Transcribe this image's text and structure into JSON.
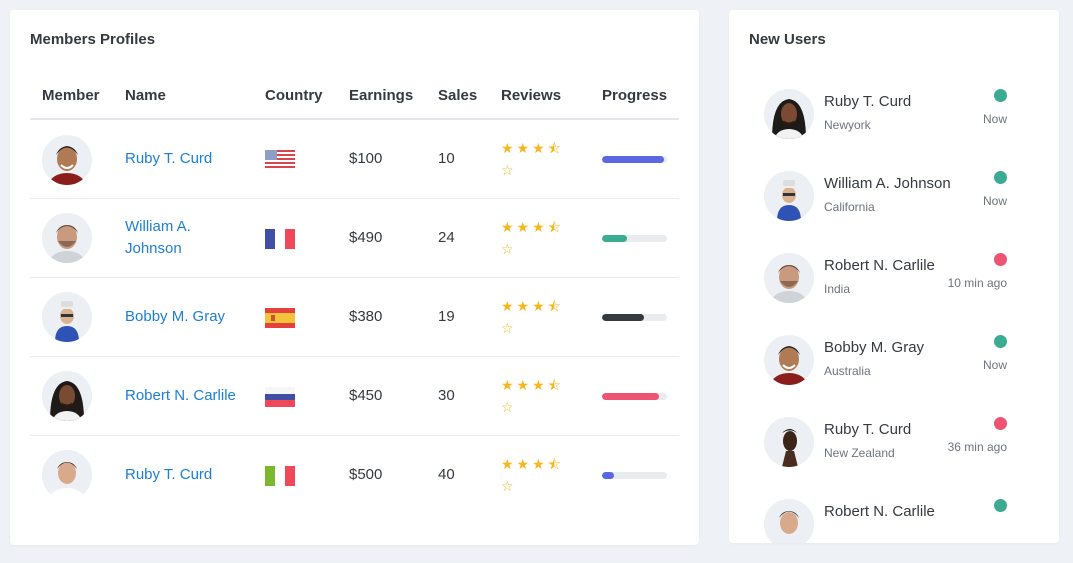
{
  "members": {
    "title": "Members Profiles",
    "columns": [
      "Member",
      "Name",
      "Country",
      "Earnings",
      "Sales",
      "Reviews",
      "Progress"
    ],
    "rows": [
      {
        "name": "Ruby T. Curd",
        "country_flag": "us-flag-icon",
        "earnings": "$100",
        "sales": "10",
        "rating_stars": 3.5,
        "progress": 0.95,
        "progress_color": "#5b67e3"
      },
      {
        "name": "William A. Johnson",
        "country_flag": "france-flag-icon",
        "earnings": "$490",
        "sales": "24",
        "rating_stars": 3.5,
        "progress": 0.38,
        "progress_color": "#3bab91"
      },
      {
        "name": "Bobby M. Gray",
        "country_flag": "spain-flag-icon",
        "earnings": "$380",
        "sales": "19",
        "rating_stars": 3.5,
        "progress": 0.65,
        "progress_color": "#343a40"
      },
      {
        "name": "Robert N. Carlile",
        "country_flag": "russia-flag-icon",
        "earnings": "$450",
        "sales": "30",
        "rating_stars": 3.5,
        "progress": 0.88,
        "progress_color": "#ec5471"
      },
      {
        "name": "Ruby T. Curd",
        "country_flag": "italy-flag-icon",
        "earnings": "$500",
        "sales": "40",
        "rating_stars": 3.5,
        "progress": 0.18,
        "progress_color": "#5b67e3"
      }
    ]
  },
  "new_users": {
    "title": "New Users",
    "items": [
      {
        "name": "Ruby T. Curd",
        "location": "Newyork",
        "time": "Now",
        "status_color": "#3bab91"
      },
      {
        "name": "William A. Johnson",
        "location": "California",
        "time": "Now",
        "status_color": "#3bab91"
      },
      {
        "name": "Robert N. Carlile",
        "location": "India",
        "time": "10 min ago",
        "status_color": "#ec5471"
      },
      {
        "name": "Bobby M. Gray",
        "location": "Australia",
        "time": "Now",
        "status_color": "#3bab91"
      },
      {
        "name": "Ruby T. Curd",
        "location": "New Zealand",
        "time": "36 min ago",
        "status_color": "#ec5471"
      },
      {
        "name": "Robert N. Carlile",
        "location": "",
        "time": "",
        "status_color": "#3bab91"
      }
    ]
  },
  "colors": {
    "link": "#1a7fd6",
    "star": "#f5b61e",
    "online": "#3bab91",
    "away": "#ec5471"
  }
}
